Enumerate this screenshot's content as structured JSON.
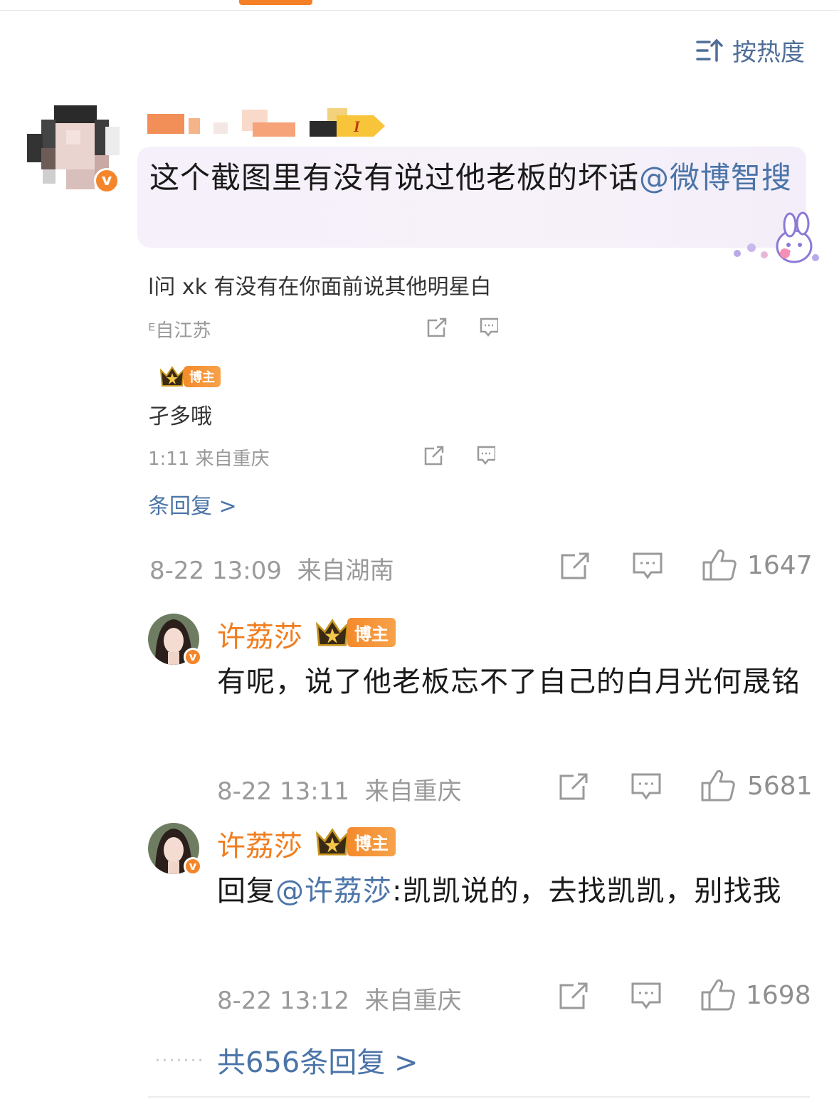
{
  "sort": {
    "label": "按热度"
  },
  "main_comment": {
    "text": "这个截图里有没有说过他老板的坏话",
    "mention": "@微博智搜",
    "timestamp": "8-22 13:09",
    "location": "来自湖南",
    "likes": "1647"
  },
  "thread_preview": {
    "q_text": "l问 xk 有没有在你面前说其他明星白",
    "q_meta": "ᴱ自江苏",
    "a_text": "孑多哦",
    "a_badge": "博主",
    "a_meta": "1:11  来自重庆",
    "more": "条回复 >"
  },
  "replies": [
    {
      "name": "许荔莎",
      "badge": "博主",
      "text": "有呢，说了他老板忘不了自己的白月光何晟铭",
      "timestamp": "8-22 13:11",
      "location": "来自重庆",
      "likes": "5681"
    },
    {
      "name": "许荔莎",
      "badge": "博主",
      "prefix": "回复",
      "mention": "@许荔莎",
      "text": ":凯凯说的，去找凯凯，别找我",
      "timestamp": "8-22 13:12",
      "location": "来自重庆",
      "likes": "1698"
    }
  ],
  "total_replies": "共656条回复 >",
  "icons": [
    "sort-icon",
    "share-icon",
    "comment-icon",
    "like-icon",
    "verified-icon",
    "crown-icon"
  ],
  "colors": {
    "accent": "#f58025",
    "link": "#4b74a8",
    "meta": "#9a9a9a"
  }
}
